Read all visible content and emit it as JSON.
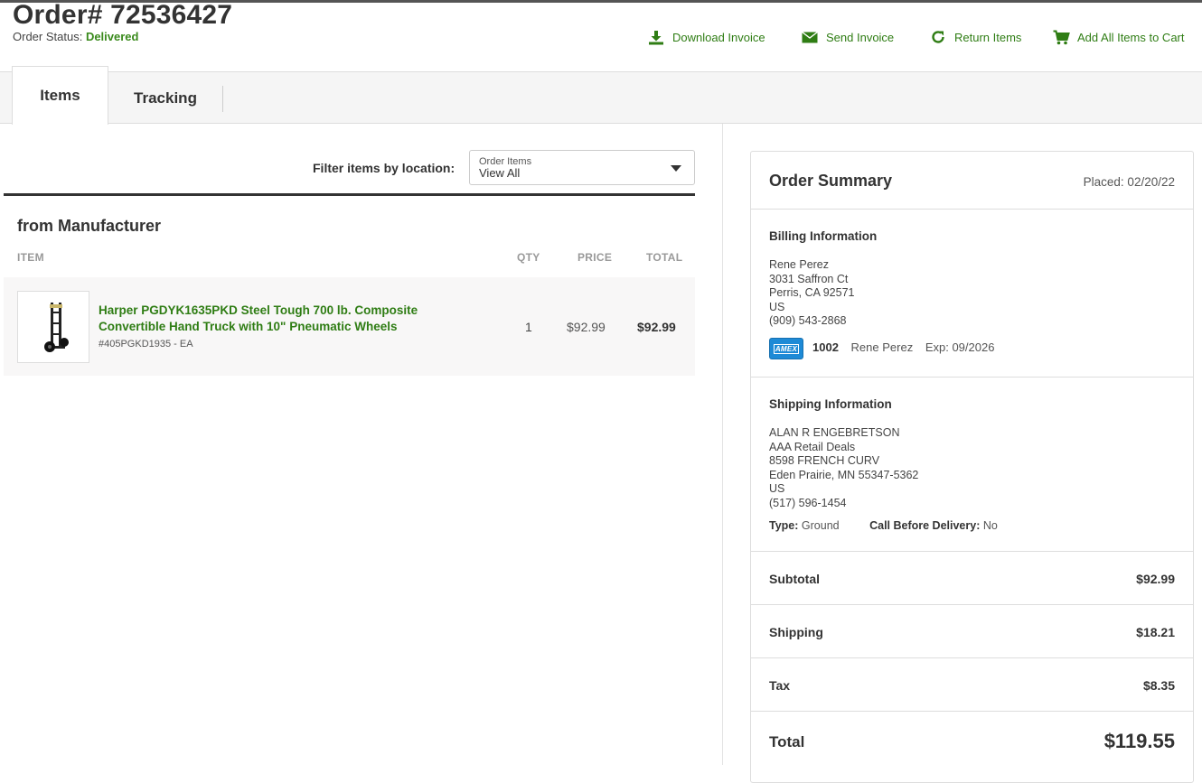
{
  "header": {
    "order_title": "Order# 72536427",
    "status_label": "Order Status:",
    "status_value": "Delivered"
  },
  "actions": {
    "download": {
      "label": "Download Invoice",
      "icon": "download-icon"
    },
    "send": {
      "label": "Send Invoice",
      "icon": "envelope-icon"
    },
    "return": {
      "label": "Return Items",
      "icon": "refresh-icon"
    },
    "add_cart": {
      "label": "Add All Items to Cart",
      "icon": "cart-icon"
    }
  },
  "tabs": [
    {
      "label": "Items",
      "active": true
    },
    {
      "label": "Tracking",
      "active": false
    }
  ],
  "filter": {
    "label": "Filter items by location:",
    "select_caption": "Order Items",
    "select_value": "View All"
  },
  "items_section": {
    "title": "from Manufacturer",
    "columns": {
      "item": "ITEM",
      "qty": "QTY",
      "price": "PRICE",
      "total": "TOTAL"
    },
    "rows": [
      {
        "name": "Harper PGDYK1635PKD Steel Tough 700 lb. Composite Convertible Hand Truck with 10\" Pneumatic Wheels",
        "sku": "#405PGKD1935 - EA",
        "qty": "1",
        "price": "$92.99",
        "total": "$92.99"
      }
    ]
  },
  "summary": {
    "title": "Order Summary",
    "placed": "Placed: 02/20/22",
    "billing": {
      "heading": "Billing Information",
      "lines": [
        "Rene Perez",
        "3031 Saffron Ct",
        "Perris, CA 92571",
        "US",
        "(909) 543-2868"
      ],
      "card_brand": "AMEX",
      "card_last4": "1002",
      "card_name": "Rene Perez",
      "card_exp": "Exp: 09/2026"
    },
    "shipping": {
      "heading": "Shipping Information",
      "lines": [
        "ALAN R ENGEBRETSON",
        "AAA Retail Deals",
        "8598 FRENCH CURV",
        "Eden Prairie, MN 55347-5362",
        "US",
        "(517) 596-1454"
      ],
      "type_label": "Type:",
      "type_value": "Ground",
      "call_label": "Call Before Delivery:",
      "call_value": "No"
    },
    "totals": {
      "subtotal_label": "Subtotal",
      "subtotal": "$92.99",
      "shipping_label": "Shipping",
      "shipping": "$18.21",
      "tax_label": "Tax",
      "tax": "$8.35",
      "total_label": "Total",
      "total": "$119.55"
    }
  },
  "colors": {
    "accent_green": "#2f7d14",
    "status_green": "#3a8a1c",
    "amex_blue": "#1e8ad6"
  }
}
